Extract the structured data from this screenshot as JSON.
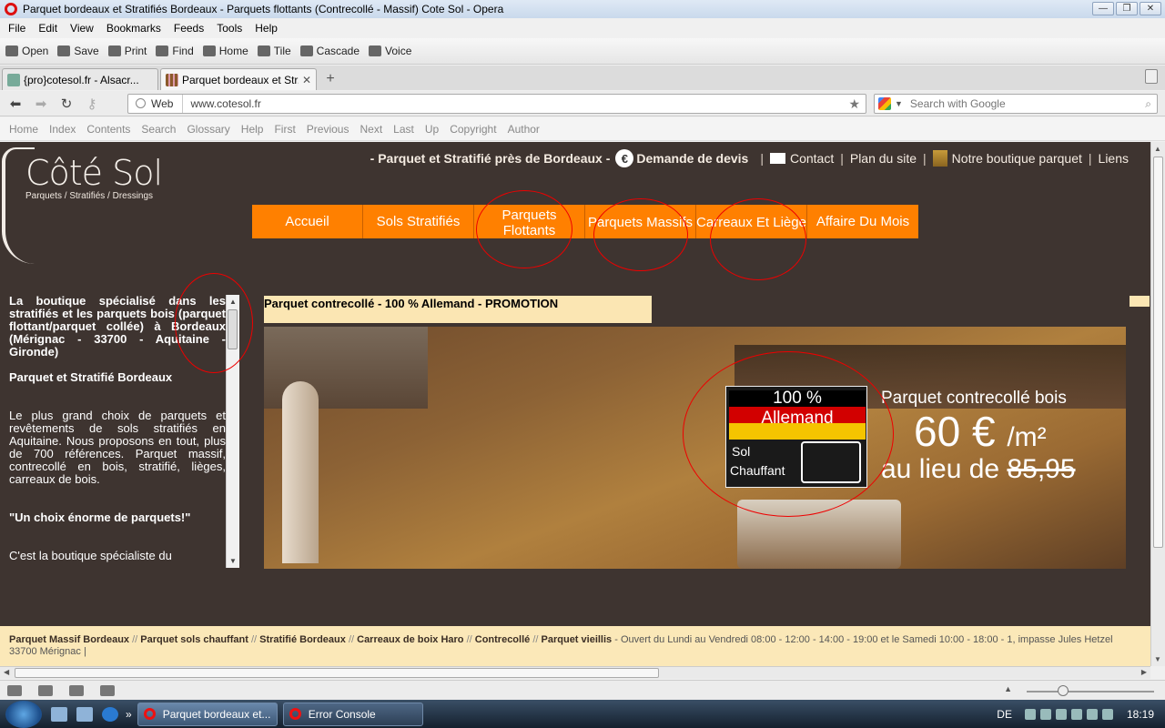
{
  "window": {
    "title": "Parquet bordeaux et Stratifiés Bordeaux - Parquets flottants (Contrecollé - Massif) Cote Sol - Opera"
  },
  "menubar": [
    "File",
    "Edit",
    "View",
    "Bookmarks",
    "Feeds",
    "Tools",
    "Help"
  ],
  "toolbar": [
    "Open",
    "Save",
    "Print",
    "Find",
    "Home",
    "Tile",
    "Cascade",
    "Voice"
  ],
  "tabs": [
    {
      "label": "{pro}cotesol.fr - Alsacr...",
      "active": false
    },
    {
      "label": "Parquet bordeaux et Str...",
      "active": true
    }
  ],
  "address": {
    "mode": "Web",
    "url": "www.cotesol.fr"
  },
  "search": {
    "placeholder": "Search with Google"
  },
  "navbar": [
    "Home",
    "Index",
    "Contents",
    "Search",
    "Glossary",
    "Help",
    "First",
    "Previous",
    "Next",
    "Last",
    "Up",
    "Copyright",
    "Author"
  ],
  "site": {
    "logo": {
      "title": "Côté Sol",
      "subtitle": "Parquets / Stratifiés / Dressings"
    },
    "toplinks": {
      "tagline": "- Parquet et Stratifié près de Bordeaux -",
      "euro_symbol": "€",
      "devis": "Demande de devis",
      "contact": "Contact",
      "plan": "Plan du site",
      "boutique": "Notre boutique parquet",
      "liens": "Liens",
      "sep": "|"
    },
    "mainnav": [
      "Accueil",
      "Sols Stratifiés",
      "Parquets Flottants",
      "Parquets Massifs",
      "Carreaux Et Liège",
      "Affaire Du Mois"
    ],
    "sidebar": {
      "intro": "La boutique spécialisé dans les stratifiés et les parquets bois (parquet flottant/parquet collée) à Bordeaux (Mérignac - 33700 - Aquitaine - Gironde)",
      "heading": "Parquet et Stratifié Bordeaux",
      "body": "Le plus grand choix de parquets et revêtements de sols stratifiés en Aquitaine. Nous proposons en tout, plus de 700 références. Parquet massif, contrecollé en bois, stratifié, lièges, carreaux de bois.",
      "quote": "\"Un choix énorme de parquets!\"",
      "cut": "C'est la boutique spécialiste du"
    },
    "promo": {
      "title": "Parquet contrecollé - 100 % Allemand - PROMOTION",
      "badge_line1": "100 %",
      "badge_line2": "Allemand",
      "badge_sol": "Sol",
      "badge_chauffant": "Chauffant",
      "price_label": "Parquet contrecollé bois",
      "price": "60 €",
      "price_unit": "/m²",
      "old_price_prefix": "au lieu de",
      "old_price": "85,95"
    },
    "footer": {
      "links": [
        "Parquet Massif Bordeaux",
        "Parquet sols chauffant",
        "Stratifié Bordeaux",
        "Carreaux de boix Haro",
        "Contrecollé",
        "Parquet vieillis"
      ],
      "link_sep": "//",
      "info": "- Ouvert du Lundi au Vendredi 08:00 - 12:00 - 14:00 - 19:00 et le Samedi 10:00 - 18:00 - 1, impasse Jules Hetzel",
      "address": "33700 Mérignac |"
    }
  },
  "taskbar": {
    "tasks": [
      {
        "label": "Parquet bordeaux et...",
        "active": true
      },
      {
        "label": "Error Console",
        "active": false
      }
    ],
    "lang": "DE",
    "clock": "18:19"
  },
  "colors": {
    "page_bg": "#3e3430",
    "nav_orange": "#ff8000",
    "promo_bg": "#fbe6b3",
    "annotation": "#e00000"
  }
}
